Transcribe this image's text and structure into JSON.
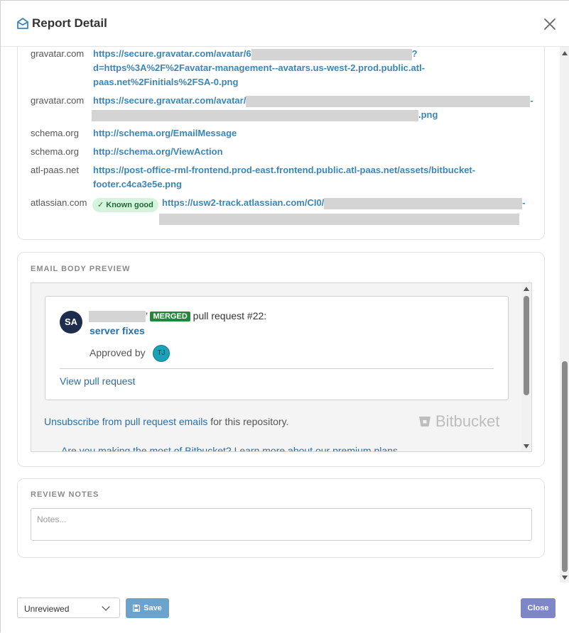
{
  "header": {
    "title": "Report Detail"
  },
  "links": [
    {
      "domain": "gravatar.com",
      "line1": "https://secure.gravatar.com/avatar/6",
      "line1_tail": "?",
      "line2": "d=https%3A%2F%2Favatar-management--avatars.us-west-2.prod.public.atl-",
      "line3": "paas.net%2Finitials%2FSA-0.png"
    },
    {
      "domain": "gravatar.com",
      "line1": "https://secure.gravatar.com/avatar/",
      "line1_tail": "-",
      "line2_tail": ".png"
    },
    {
      "domain": "schema.org",
      "line1": "http://schema.org/EmailMessage"
    },
    {
      "domain": "schema.org",
      "line1": "http://schema.org/ViewAction"
    },
    {
      "domain": "atl-paas.net",
      "line1": "https://post-office-rml-frontend.prod-east.frontend.public.atl-paas.net/assets/bitbucket-",
      "line2": "footer.c4ca3e5e.png"
    },
    {
      "domain": "atlassian.com",
      "badge": "✓ Known good",
      "line1": "https://usw2-track.atlassian.com/CI0/",
      "line1_tail": "-"
    }
  ],
  "preview": {
    "section_label": "EMAIL BODY PREVIEW",
    "avatar_initials": "SA",
    "merged_badge": "MERGED",
    "action_text": "pull request #22:",
    "pr_title": "server fixes",
    "approved_by": "Approved by",
    "approver_initials": "TJ",
    "view_link": "View pull request",
    "unsubscribe_link": "Unsubscribe from pull request emails",
    "unsubscribe_rest": "for this repository.",
    "brand": "Bitbucket",
    "more_text": "Are you making the most of Bitbucket? Learn more about our premium plans"
  },
  "notes": {
    "section_label": "REVIEW NOTES",
    "placeholder": "Notes..."
  },
  "footer": {
    "status_value": "Unreviewed",
    "save_label": "Save",
    "close_label": "Close"
  },
  "colors": {
    "link": "#3b86b8",
    "merged": "#218838",
    "save": "#6ba3cf",
    "close": "#7d86c9",
    "known_good_bg": "#d4f4dd"
  }
}
